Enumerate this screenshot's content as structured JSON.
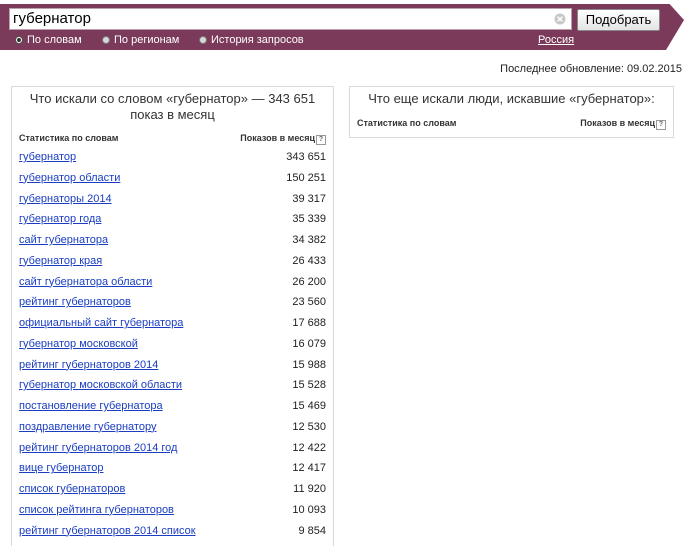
{
  "search": {
    "query": "губернатор",
    "button_label": "Подобрать"
  },
  "tabs": [
    {
      "label": "По словам",
      "selected": true
    },
    {
      "label": "По регионам",
      "selected": false
    },
    {
      "label": "История запросов",
      "selected": false
    }
  ],
  "region": "Россия",
  "last_update": "Последнее обновление: 09.02.2015",
  "left_panel": {
    "title_line1": "Что искали со словом «губернатор» — 343 651",
    "title_line2": "показ в месяц",
    "col_keyword": "Статистика по словам",
    "col_count": "Показов в месяц",
    "help": "?",
    "rows": [
      {
        "keyword": "губернатор",
        "count": "343 651"
      },
      {
        "keyword": "губернатор области",
        "count": "150 251"
      },
      {
        "keyword": "губернаторы 2014",
        "count": "39 317"
      },
      {
        "keyword": "губернатор года",
        "count": "35 339"
      },
      {
        "keyword": "сайт губернатора",
        "count": "34 382"
      },
      {
        "keyword": "губернатор края",
        "count": "26 433"
      },
      {
        "keyword": "сайт губернатора области",
        "count": "26 200"
      },
      {
        "keyword": "рейтинг губернаторов",
        "count": "23 560"
      },
      {
        "keyword": "официальный сайт губернатора",
        "count": "17 688"
      },
      {
        "keyword": "губернатор московской",
        "count": "16 079"
      },
      {
        "keyword": "рейтинг губернаторов 2014",
        "count": "15 988"
      },
      {
        "keyword": "губернатор московской области",
        "count": "15 528"
      },
      {
        "keyword": "постановление губернатора",
        "count": "15 469"
      },
      {
        "keyword": "поздравление губернатору",
        "count": "12 530"
      },
      {
        "keyword": "рейтинг губернаторов 2014 год",
        "count": "12 422"
      },
      {
        "keyword": "вице губернатор",
        "count": "12 417"
      },
      {
        "keyword": "список губернаторов",
        "count": "11 920"
      },
      {
        "keyword": "список рейтинга губернаторов",
        "count": "10 093"
      },
      {
        "keyword": "рейтинг губернаторов 2014 список",
        "count": "9 854"
      }
    ]
  },
  "right_panel": {
    "title": "Что еще искали люди, искавшие «губернатор»:",
    "col_keyword": "Статистика по словам",
    "col_count": "Показов в месяц",
    "help": "?"
  },
  "colors": {
    "header_band": "#7b3a5a",
    "link": "#1a3dc1"
  }
}
